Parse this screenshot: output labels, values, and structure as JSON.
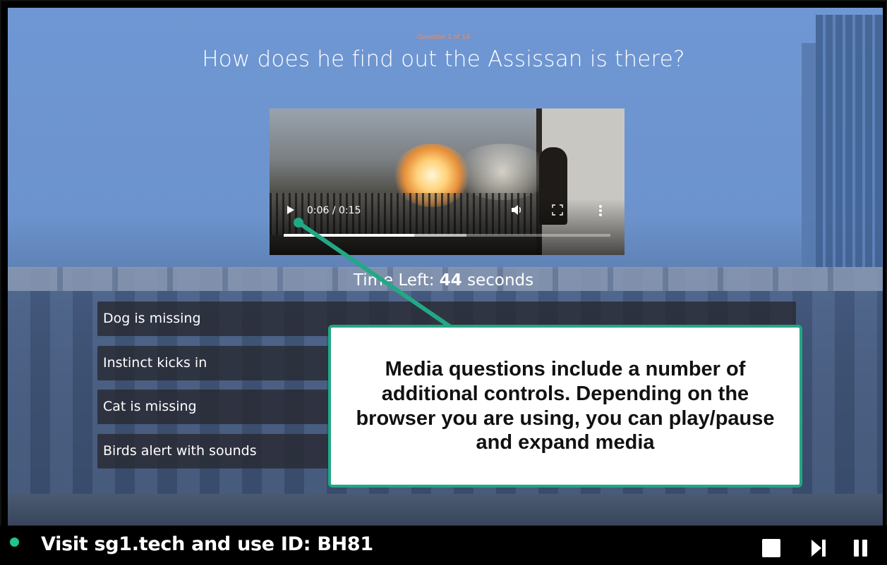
{
  "quiz": {
    "question_counter": "Question 1 of 14",
    "question_text": "How does he find out the Assissan is there?",
    "time_left_prefix": "Time Left:",
    "time_left_value": "44",
    "time_left_suffix": "seconds",
    "answers": [
      {
        "label": "Dog is missing"
      },
      {
        "label": "Instinct kicks in"
      },
      {
        "label": "Cat is missing"
      },
      {
        "label": "Birds alert with sounds"
      }
    ]
  },
  "video_player": {
    "time_display": "0:06 / 0:15",
    "progress_fraction": 0.4,
    "buffered_fraction": 0.56,
    "icons": [
      "play-icon",
      "volume-icon",
      "fullscreen-icon",
      "more-options-icon"
    ]
  },
  "callout": {
    "text": "Media questions include a number of additional controls. Depending on the browser you are using, you can play/pause and expand media",
    "border_color": "#22a884"
  },
  "footer": {
    "message": "Visit sg1.tech and use ID: BH81",
    "status_color": "#22c48e",
    "controls": [
      "stop-icon",
      "next-icon",
      "pause-icon"
    ]
  }
}
